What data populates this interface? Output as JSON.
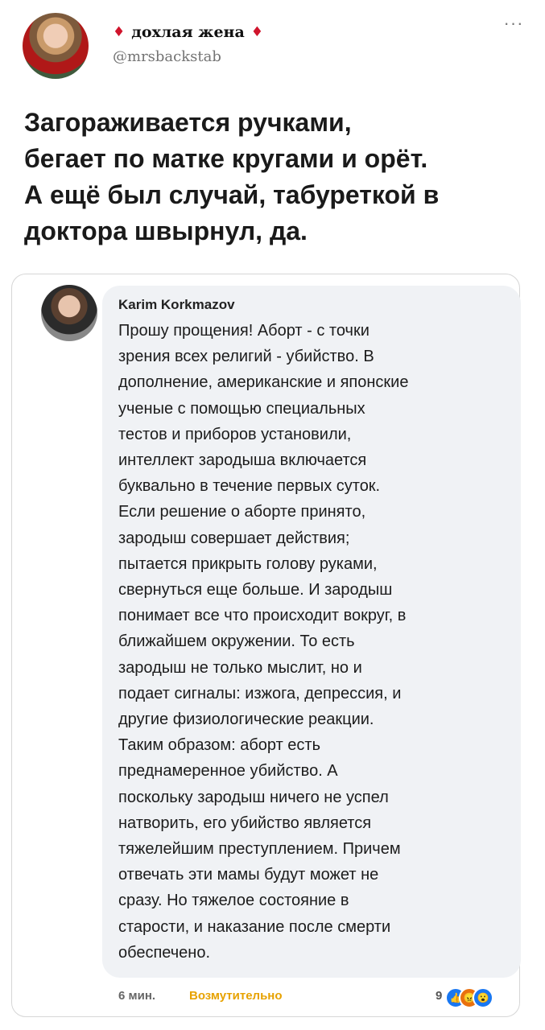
{
  "tweet": {
    "display_name": "дохлая жена",
    "handle": "@mrsbackstab",
    "more_icon": "more-horizontal-icon",
    "text": "Загораживается ручками,\nбегает по матке кругами и орёт.\nА ещё был случай, табуреткой в\nдоктора швырнул, да."
  },
  "embedded_comment": {
    "author": "Karim Korkmazov",
    "text": "Прошу прощения! Аборт - с точки\nзрения всех религий - убийство. В\nдополнение, американские и японские\nученые с помощью специальных\nтестов и приборов установили,\nинтеллект зародыша включается\nбуквально в течение первых суток.\nЕсли решение о аборте принято,\nзародыш совершает действия;\nпытается прикрыть голову руками,\nсвернуться еще больше. И зародыш\nпонимает все что происходит вокруг, в\nближайшем окружении. То есть\nзародыш не только мыслит, но и\nподает сигналы: изжога, депрессия, и\nдругие физиологические реакции.\nТаким образом: аборт есть\nпреднамеренное убийство. А\nпоскольку зародыш ничего не успел\nнатворить, его убийство является\nтяжелейшим преступлением. Причем\nотвечать эти мамы будут может не\nсразу. Но тяжелое состояние в\nстарости, и наказание после смерти\nобеспечено.",
    "time": "6 мин.",
    "reaction_label": "Возмутительно",
    "reaction_count": "9"
  },
  "colors": {
    "diamond": "#d0142c",
    "reaction_label": "#e7a200",
    "bubble": "#f0f2f5"
  }
}
